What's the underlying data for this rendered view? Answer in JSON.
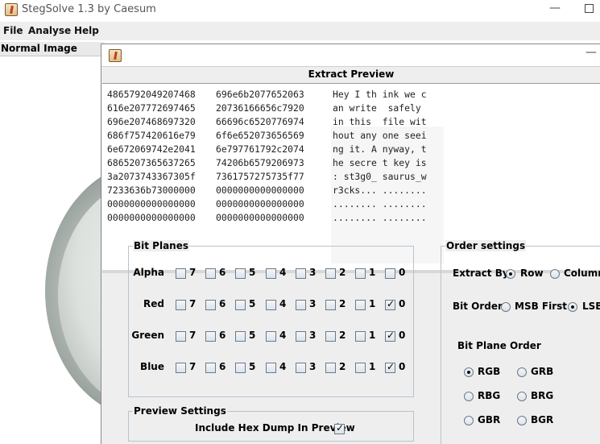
{
  "app": {
    "title": "StegSolve 1.3 by Caesum",
    "minimize_glyph": "—"
  },
  "menu": [
    "File",
    "Analyse",
    "Help"
  ],
  "left_panel": {
    "label": "Normal Image"
  },
  "extract": {
    "title": "Extract Preview",
    "minimize_glyph": "—",
    "hex_rows": [
      [
        "4865792049207468",
        "696e6b2077652063",
        "Hey I th ink we c"
      ],
      [
        "616e207772697465",
        "20736166656c7920",
        "an write  safely "
      ],
      [
        "696e207468697320",
        "66696c6520776974",
        "in this  file wit"
      ],
      [
        "686f757420616e79",
        "6f6e652073656569",
        "hout any one seei"
      ],
      [
        "6e672069742e2041",
        "6e797761792c2074",
        "ng it. A nyway, t"
      ],
      [
        "6865207365637265",
        "74206b6579206973",
        "he secre t key is"
      ],
      [
        "3a2073743367305f",
        "7361757275735f77",
        ": st3g0_ saurus_w"
      ],
      [
        "7233636b73000000",
        "0000000000000000",
        "r3cks... ........"
      ],
      [
        "0000000000000000",
        "0000000000000000",
        "........ ........"
      ],
      [
        "0000000000000000",
        "0000000000000000",
        "........ ........"
      ]
    ],
    "bit_planes": {
      "title": "Bit Planes",
      "bits": [
        "7",
        "6",
        "5",
        "4",
        "3",
        "2",
        "1",
        "0"
      ],
      "channels": [
        {
          "name": "Alpha",
          "checked": [
            false,
            false,
            false,
            false,
            false,
            false,
            false,
            false
          ]
        },
        {
          "name": "Red",
          "checked": [
            false,
            false,
            false,
            false,
            false,
            false,
            false,
            true
          ]
        },
        {
          "name": "Green",
          "checked": [
            false,
            false,
            false,
            false,
            false,
            false,
            false,
            true
          ]
        },
        {
          "name": "Blue",
          "checked": [
            false,
            false,
            false,
            false,
            false,
            false,
            false,
            true
          ]
        }
      ]
    },
    "preview_settings": {
      "title": "Preview Settings",
      "include_hex_label": "Include Hex Dump In Preview",
      "include_hex_checked": true
    },
    "order_settings": {
      "title": "Order settings",
      "extract_by_label": "Extract By",
      "extract_by_options": [
        "Row",
        "Column"
      ],
      "extract_by_selected": "Row",
      "bit_order_label": "Bit Order",
      "bit_order_options": [
        "MSB First",
        "LSB"
      ],
      "bit_order_selected": "LSB",
      "bit_plane_order_label": "Bit Plane Order",
      "bit_plane_order_options": [
        [
          "RGB",
          "GRB"
        ],
        [
          "RBG",
          "BRG"
        ],
        [
          "GBR",
          "BGR"
        ]
      ],
      "bit_plane_order_selected": "RGB"
    }
  }
}
